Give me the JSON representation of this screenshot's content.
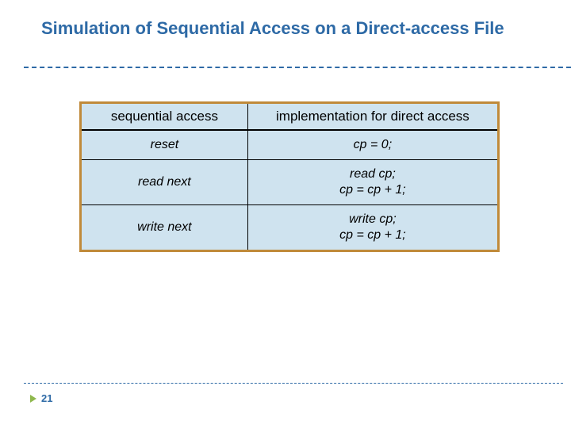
{
  "title": "Simulation of Sequential Access on a Direct-access File",
  "table": {
    "headers": {
      "col1": "sequential access",
      "col2": "implementation for direct access"
    },
    "rows": [
      {
        "op": "reset",
        "impl1": "cp = 0;",
        "impl2": ""
      },
      {
        "op": "read next",
        "impl1": "read cp;",
        "impl2": "cp = cp + 1;"
      },
      {
        "op": "write next",
        "impl1": "write cp;",
        "impl2": "cp = cp + 1;"
      }
    ]
  },
  "page_number": "21"
}
